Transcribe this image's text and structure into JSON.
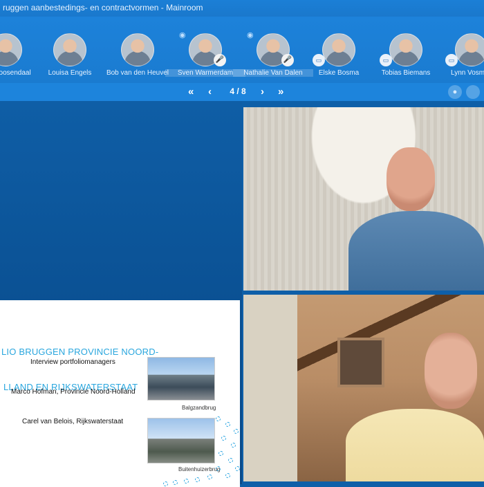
{
  "window": {
    "title": "ruggen aanbestedings- en contractvormen - Mainroom"
  },
  "participants": [
    {
      "name": "Roosendaal",
      "mic_muted": false,
      "screen": false,
      "active": false,
      "speaking": false
    },
    {
      "name": "Louisa Engels",
      "mic_muted": false,
      "screen": false,
      "active": false,
      "speaking": false
    },
    {
      "name": "Bob van den Heuvel",
      "mic_muted": false,
      "screen": false,
      "active": false,
      "speaking": false
    },
    {
      "name": "Sven Warmerdam",
      "mic_muted": true,
      "screen": false,
      "active": true,
      "speaking": true
    },
    {
      "name": "Nathalie Van Dalen",
      "mic_muted": true,
      "screen": false,
      "active": true,
      "speaking": true
    },
    {
      "name": "Elske Bosma",
      "mic_muted": false,
      "screen": true,
      "active": false,
      "speaking": false
    },
    {
      "name": "Tobias Biemans",
      "mic_muted": false,
      "screen": true,
      "active": false,
      "speaking": false
    },
    {
      "name": "Lynn Vosm",
      "mic_muted": false,
      "screen": true,
      "active": false,
      "speaking": false
    }
  ],
  "navigation": {
    "first": "«",
    "prev": "‹",
    "next": "›",
    "last": "»",
    "page": "4 / 8"
  },
  "slide": {
    "title_line1": "LIO BRUGGEN PROVINCIE NOORD-",
    "title_line2": "LLAND EN RIJKSWATERSTAAT",
    "line1": "Interview portfoliomanagers",
    "line2": "Marco Hofman, Provincie Noord-Holland",
    "line3": "Carel van Belois, Rijkswaterstaat",
    "caption1": "Balgzandbrug",
    "caption2": "Buitenhuizerbrug"
  },
  "icons": {
    "mic": "microphone-icon",
    "screen": "screen-share-icon",
    "speaking": "speaker-wave-icon"
  },
  "colors": {
    "accent": "#1d84dc",
    "slide_title": "#29a6de",
    "muted_mic": "#d9413b"
  }
}
